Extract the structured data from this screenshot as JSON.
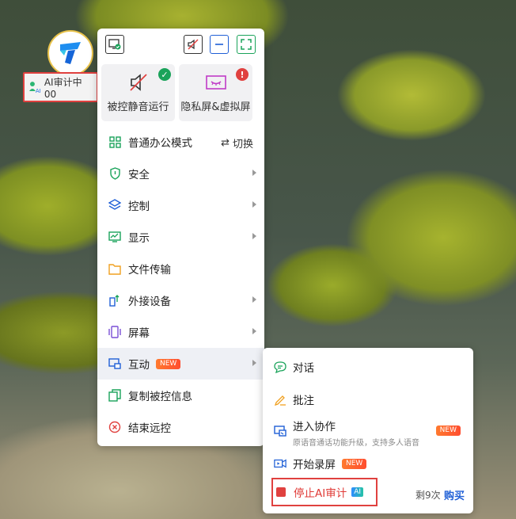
{
  "badge": {
    "text": "AI审计中 00"
  },
  "toolbar": {
    "screen_icon": "screen-check-icon",
    "mute_icon": "speaker-mute-icon",
    "minimize_icon": "minimize-icon",
    "fullscreen_icon": "fullscreen-icon"
  },
  "cards": [
    {
      "label": "被控静音运行",
      "status": "check"
    },
    {
      "label": "隐私屏&虚拟屏",
      "status": "!"
    }
  ],
  "menu": {
    "office_mode": "普通办公模式",
    "switch_label": "切换",
    "items": [
      {
        "label": "安全"
      },
      {
        "label": "控制"
      },
      {
        "label": "显示"
      },
      {
        "label": "文件传输"
      },
      {
        "label": "外接设备"
      },
      {
        "label": "屏幕"
      },
      {
        "label": "互动",
        "tag": "NEW"
      },
      {
        "label": "复制被控信息"
      },
      {
        "label": "结束远控"
      }
    ]
  },
  "submenu": {
    "chat": "对话",
    "annotate": "批注",
    "collab_title": "进入协作",
    "collab_desc": "原语音通话功能升级，支持多人语音",
    "collab_tag": "NEW",
    "record": "开始录屏",
    "record_tag": "NEW",
    "stop_audit": "停止AI审计",
    "stop_tag": "AI",
    "remaining": "剩9次",
    "buy": "购买"
  },
  "colors": {
    "accent_green": "#1aa35a",
    "danger_red": "#e0413f",
    "link_blue": "#1f5fd6"
  }
}
